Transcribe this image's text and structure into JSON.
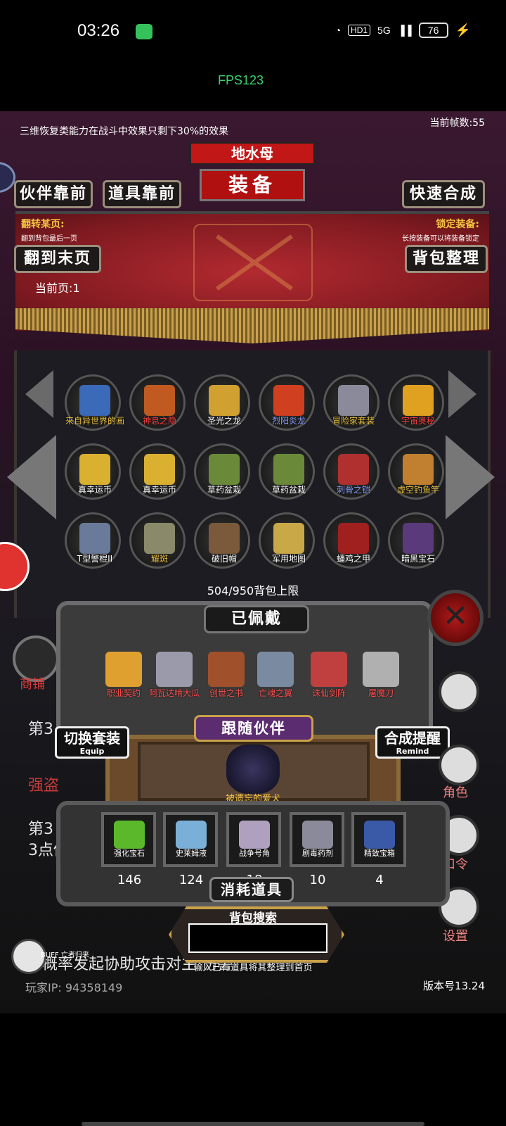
{
  "status": {
    "time": "03:26",
    "hd": "HD1",
    "network": "5G",
    "battery": "76"
  },
  "fps": "FPS123",
  "top_hint": "三维恢复类能力在战斗中效果只剩下30%的效果",
  "frame_count": "当前帧数:55",
  "title": {
    "top": "地水母",
    "main": "装备"
  },
  "buttons": {
    "partner_first": "伙伴靠前",
    "item_first": "道具靠前",
    "quick_merge": "快速合成",
    "last_page": "翻到末页",
    "sort_bag": "背包整理",
    "switch_set": "切换套装",
    "switch_set_sub": "Equip",
    "merge_remind": "合成提醒",
    "merge_remind_sub": "Remind"
  },
  "labels": {
    "jump_page": "翻转某页:",
    "jump_page_desc": "翻到背包最后一页",
    "lock_equip": "锁定装备:",
    "lock_equip_desc": "长按装备可以将装备锁定",
    "current_page": "当前页:1",
    "capacity": "504/950背包上限",
    "worn": "已佩戴",
    "follow": "跟随伙伴",
    "pet_name": "被遗忘的爱犬",
    "consumables": "消耗道具",
    "search_title": "背包搜索",
    "search_hint": "输入已有道具将其整理到首页"
  },
  "search": {
    "value": ""
  },
  "inventory": [
    {
      "name": "来自异世界的画",
      "color": "#e8c040",
      "icon_color": "#3a6ab8"
    },
    {
      "name": "神息之隐",
      "color": "#ff4040",
      "icon_color": "#c05a20"
    },
    {
      "name": "圣光之龙",
      "color": "#ffffff",
      "icon_color": "#d0a030"
    },
    {
      "name": "烈阳炎龙",
      "color": "#8aa0ff",
      "icon_color": "#d04020"
    },
    {
      "name": "冒险家套装",
      "color": "#e8c040",
      "icon_color": "#8a8a9a"
    },
    {
      "name": "宇宙奥秘",
      "color": "#ff4040",
      "icon_color": "#e0a020"
    },
    {
      "name": "真幸运币",
      "color": "#ffffff",
      "icon_color": "#d9b030"
    },
    {
      "name": "真幸运币",
      "color": "#ffffff",
      "icon_color": "#d9b030"
    },
    {
      "name": "草药盆栽",
      "color": "#ffffff",
      "icon_color": "#6a8a3a"
    },
    {
      "name": "草药盆栽",
      "color": "#ffffff",
      "icon_color": "#6a8a3a"
    },
    {
      "name": "刺骨之铠",
      "color": "#8aa0ff",
      "icon_color": "#b03030"
    },
    {
      "name": "虚空钓鱼竿",
      "color": "#e8c040",
      "icon_color": "#c08030"
    },
    {
      "name": "T型警棍II",
      "color": "#ffffff",
      "icon_color": "#6a7a9a"
    },
    {
      "name": "耀斑",
      "color": "#e8c040",
      "icon_color": "#8a8a6a"
    },
    {
      "name": "破旧帽",
      "color": "#ffffff",
      "icon_color": "#7a5a3a"
    },
    {
      "name": "军用地图",
      "color": "#ffffff",
      "icon_color": "#c9a848"
    },
    {
      "name": "蟠鸡之甲",
      "color": "#ffffff",
      "icon_color": "#a02020"
    },
    {
      "name": "暗黑宝石",
      "color": "#ffffff",
      "icon_color": "#5a3a7a"
    }
  ],
  "worn": [
    {
      "name": "职业契约",
      "icon_color": "#e0a030"
    },
    {
      "name": "阿瓦达啃大瓜",
      "icon_color": "#9a9aaa"
    },
    {
      "name": "创世之书",
      "icon_color": "#a0502a"
    },
    {
      "name": "亡魂之翼",
      "icon_color": "#7a8aa0"
    },
    {
      "name": "诛仙剑阵",
      "icon_color": "#c04040"
    },
    {
      "name": "屠魔刀",
      "icon_color": "#b0b0b0"
    }
  ],
  "consumables": [
    {
      "name": "强化宝石",
      "count": "146",
      "icon_color": "#5ab82a"
    },
    {
      "name": "史莱姆液",
      "count": "124",
      "icon_color": "#7ab0d8"
    },
    {
      "name": "战争号角",
      "count": "18",
      "icon_color": "#b0a0c0"
    },
    {
      "name": "剧毒药剂",
      "count": "10",
      "icon_color": "#8a8a9a"
    },
    {
      "name": "精致宝箱",
      "count": "4",
      "icon_color": "#3a5aa8"
    }
  ],
  "side": {
    "shop": "商铺",
    "role": "角色",
    "command": "口令",
    "settings": "设置",
    "buff_text": "BUFF 亡者归来",
    "bg_line1": "第3",
    "bg_line2": "强盗",
    "bg_line3": "第3",
    "bg_line4": "3点伤害",
    "bg_line5": "概率发起协助攻击对主 伤害"
  },
  "footer": {
    "player_ip": "玩家IP:  94358149",
    "version": "版本号13.24"
  }
}
